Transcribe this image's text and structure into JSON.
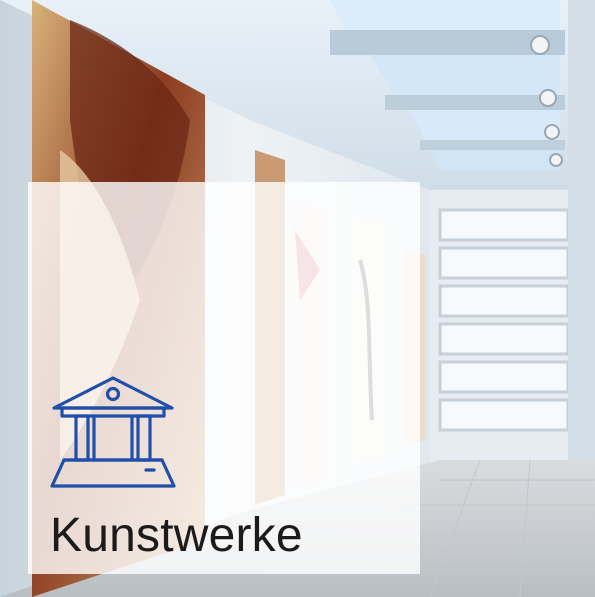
{
  "category": {
    "label": "Kunstwerke",
    "icon": "museum-building-icon"
  },
  "colors": {
    "icon_stroke": "#1f4fa8",
    "label_text": "#1b1b1b",
    "overlay": "#ffffff",
    "wall": "#e8edf1",
    "skylight": "#cfe3f5",
    "floor": "#cfd3d6"
  }
}
